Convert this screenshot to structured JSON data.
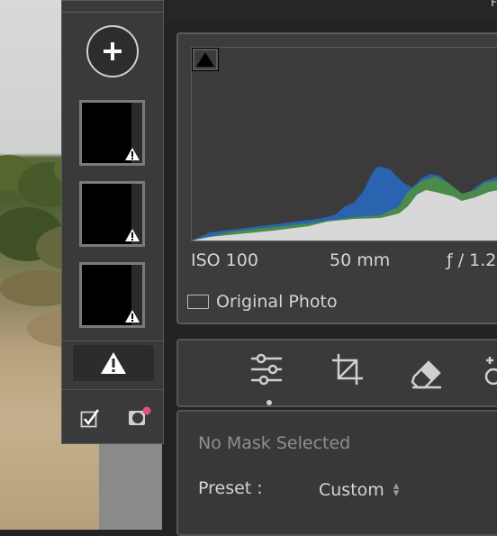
{
  "masks_panel": {
    "add_tooltip": "+",
    "thumbnails": [
      {
        "name": "mask-1"
      },
      {
        "name": "mask-2"
      },
      {
        "name": "mask-3"
      }
    ]
  },
  "header": {
    "partial_text": "F"
  },
  "histogram": {
    "iso": "ISO 100",
    "focal_length": "50 mm",
    "aperture": "ƒ / 1.2",
    "original_photo_label": "Original Photo"
  },
  "tools": [
    "edit-sliders-icon",
    "crop-icon",
    "eraser-icon",
    "heal-icon"
  ],
  "mask_settings": {
    "status": "No Mask Selected",
    "preset_label": "Preset :",
    "preset_value": "Custom"
  },
  "colors": {
    "panel_bg": "#3a3a3a",
    "histogram_blue": "#2a63b0",
    "histogram_green": "#4a8a4a",
    "histogram_fill": "#d8d8d8",
    "badge_pink": "#e0508a"
  }
}
